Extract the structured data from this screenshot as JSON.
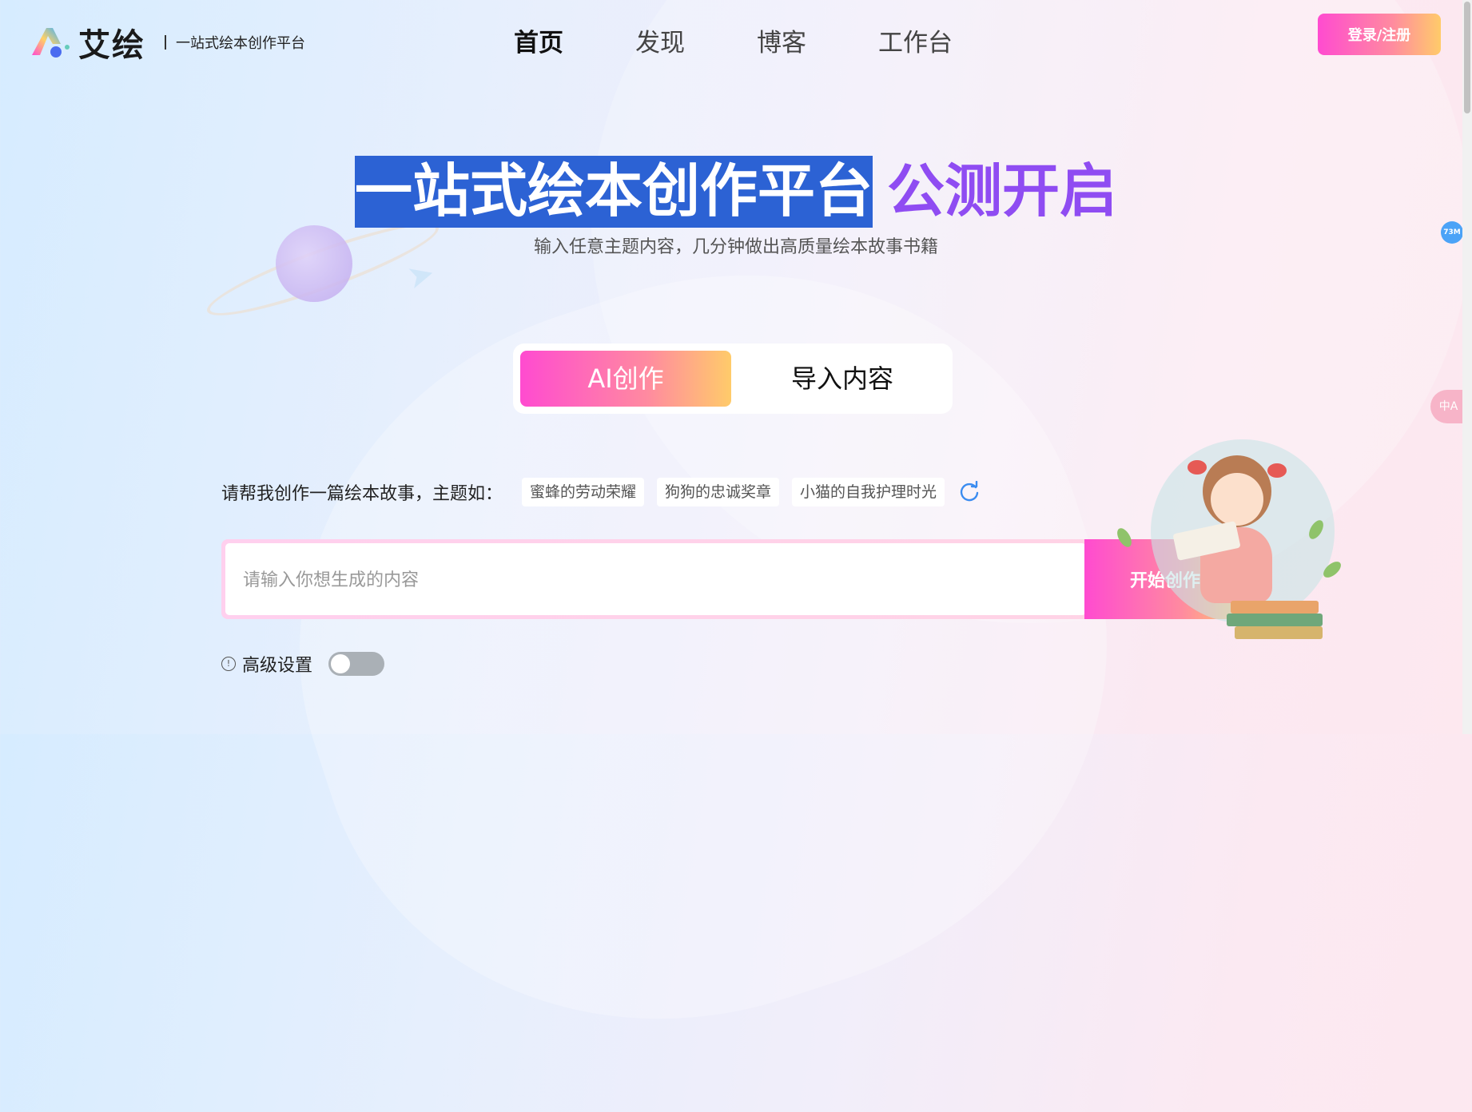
{
  "brand": {
    "name": "艾绘",
    "tagline": "一站式绘本创作平台"
  },
  "nav": {
    "items": [
      {
        "label": "首页",
        "active": true
      },
      {
        "label": "发现",
        "active": false
      },
      {
        "label": "博客",
        "active": false
      },
      {
        "label": "工作台",
        "active": false
      }
    ],
    "login_label": "登录/注册"
  },
  "hero": {
    "title_main": "一站式绘本创作平台",
    "title_accent": "公测开启",
    "subtitle": "输入任意主题内容，几分钟做出高质量绘本故事书籍"
  },
  "tabs": {
    "ai": "AI创作",
    "import": "导入内容",
    "selected": "ai"
  },
  "prompt": {
    "label": "请帮我创作一篇绘本故事，主题如：",
    "suggestions": [
      "蜜蜂的劳动荣耀",
      "狗狗的忠诚奖章",
      "小猫的自我护理时光"
    ]
  },
  "input": {
    "placeholder": "请输入你想生成的内容",
    "value": ""
  },
  "start_button": "开始创作",
  "advanced": {
    "label": "高级设置",
    "enabled": false
  },
  "widgets": {
    "memory_badge": "73M",
    "translate_glyph": "中A"
  },
  "colors": {
    "brand_gradient_start": "#ff4bd0",
    "brand_gradient_mid": "#ff8aa0",
    "brand_gradient_end": "#ffcb6a",
    "title_accent": "#8f4cf2",
    "title_highlight": "#2c62d4",
    "refresh_icon": "#3b8cf0"
  },
  "icons": [
    "logo-mark-icon",
    "refresh-icon",
    "info-icon",
    "translate-icon",
    "planet-icon",
    "paper-plane-icon"
  ]
}
